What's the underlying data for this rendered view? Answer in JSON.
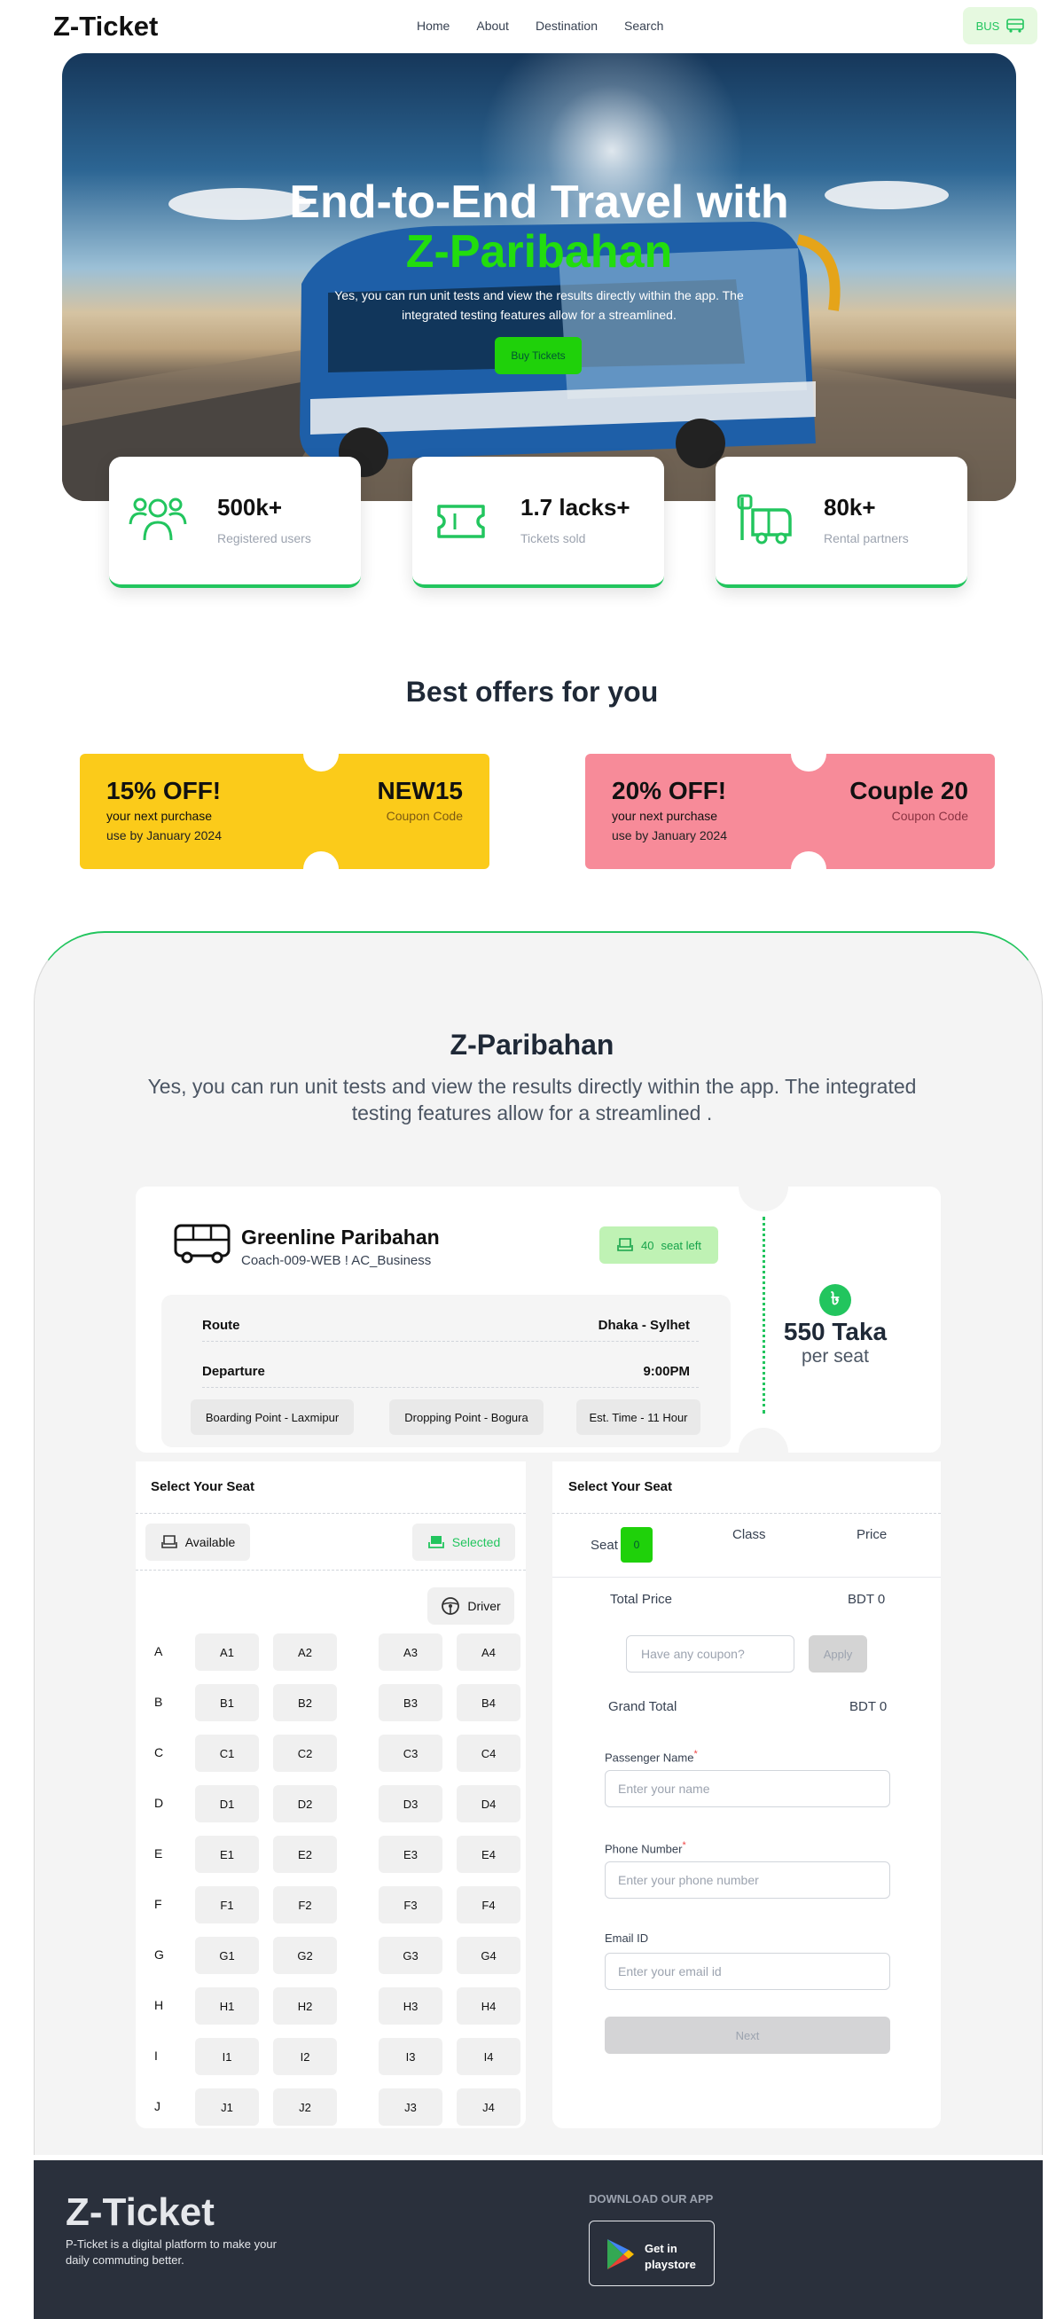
{
  "nav": {
    "logo": "Z-Ticket",
    "links": [
      "Home",
      "About",
      "Destination",
      "Search"
    ],
    "bus_label": "BUS"
  },
  "hero": {
    "title_line1": "End-to-End Travel with",
    "title_line2": "Z-Paribahan",
    "subtitle": "Yes, you can run unit tests and view the results directly within the app. The integrated testing features allow for a streamlined.",
    "cta": "Buy Tickets"
  },
  "stats": [
    {
      "icon": "users-icon",
      "value": "500k+",
      "label": "Registered users"
    },
    {
      "icon": "ticket-icon",
      "value": "1.7 lacks+",
      "label": "Tickets sold"
    },
    {
      "icon": "bus-rental-icon",
      "value": "80k+",
      "label": "Rental partners"
    }
  ],
  "offers": {
    "heading": "Best offers for you",
    "coupons": [
      {
        "discount": "15% OFF!",
        "line1": "your next purchase",
        "line2": "use by January 2024",
        "code": "NEW15",
        "code_label": "Coupon Code",
        "color": "#fbcb1a"
      },
      {
        "discount": "20% OFF!",
        "line1": "your next purchase",
        "line2": "use by January 2024",
        "code": "Couple 20",
        "code_label": "Coupon Code",
        "color": "#f78b99"
      }
    ]
  },
  "booking": {
    "title": "Z-Paribahan",
    "subtitle": "Yes, you can run unit tests and view the results directly within the app. The integrated testing features allow for a streamlined .",
    "operator": "Greenline Paribahan",
    "coach": "Coach-009-WEB ! AC_Business",
    "seats_left_count": "40",
    "seats_left_label": "seat left",
    "route_label": "Route",
    "route_value": "Dhaka - Sylhet",
    "departure_label": "Departure",
    "departure_value": "9:00PM",
    "boarding": "Boarding Point - Laxmipur",
    "dropping": "Dropping Point - Bogura",
    "est_time": "Est. Time - 11 Hour",
    "currency_symbol": "৳",
    "price": "550 Taka",
    "price_unit": "per seat"
  },
  "seat_panel": {
    "title": "Select Your Seat",
    "available_label": "Available",
    "selected_label": "Selected",
    "driver_label": "Driver",
    "rows": [
      {
        "label": "A",
        "seats": [
          "A1",
          "A2",
          "A3",
          "A4"
        ]
      },
      {
        "label": "B",
        "seats": [
          "B1",
          "B2",
          "B3",
          "B4"
        ]
      },
      {
        "label": "C",
        "seats": [
          "C1",
          "C2",
          "C3",
          "C4"
        ]
      },
      {
        "label": "D",
        "seats": [
          "D1",
          "D2",
          "D3",
          "D4"
        ]
      },
      {
        "label": "E",
        "seats": [
          "E1",
          "E2",
          "E3",
          "E4"
        ]
      },
      {
        "label": "F",
        "seats": [
          "F1",
          "F2",
          "F3",
          "F4"
        ]
      },
      {
        "label": "G",
        "seats": [
          "G1",
          "G2",
          "G3",
          "G4"
        ]
      },
      {
        "label": "H",
        "seats": [
          "H1",
          "H2",
          "H3",
          "H4"
        ]
      },
      {
        "label": "I",
        "seats": [
          "I1",
          "I2",
          "I3",
          "I4"
        ]
      },
      {
        "label": "J",
        "seats": [
          "J1",
          "J2",
          "J3",
          "J4"
        ]
      }
    ]
  },
  "summary": {
    "title": "Select Your Seat",
    "col_seat": "Seat",
    "seat_count": "0",
    "col_class": "Class",
    "col_price": "Price",
    "total_label": "Total Price",
    "total_value": "BDT 0",
    "coupon_placeholder": "Have any coupon?",
    "apply_label": "Apply",
    "grand_label": "Grand Total",
    "grand_value": "BDT 0",
    "name_label": "Passenger Name",
    "name_placeholder": "Enter your name",
    "phone_label": "Phone Number",
    "phone_placeholder": "Enter your phone number",
    "email_label": "Email ID",
    "email_placeholder": "Enter your email id",
    "next_label": "Next"
  },
  "footer": {
    "logo": "Z-Ticket",
    "text": "P-Ticket is a digital platform to make your daily commuting better.",
    "download_label": "DOWNLOAD OUR APP",
    "store_line1": "Get in",
    "store_line2": "playstore"
  },
  "colors": {
    "accent": "#1fd10a",
    "green": "#22c55e",
    "dark": "#2a303c"
  }
}
